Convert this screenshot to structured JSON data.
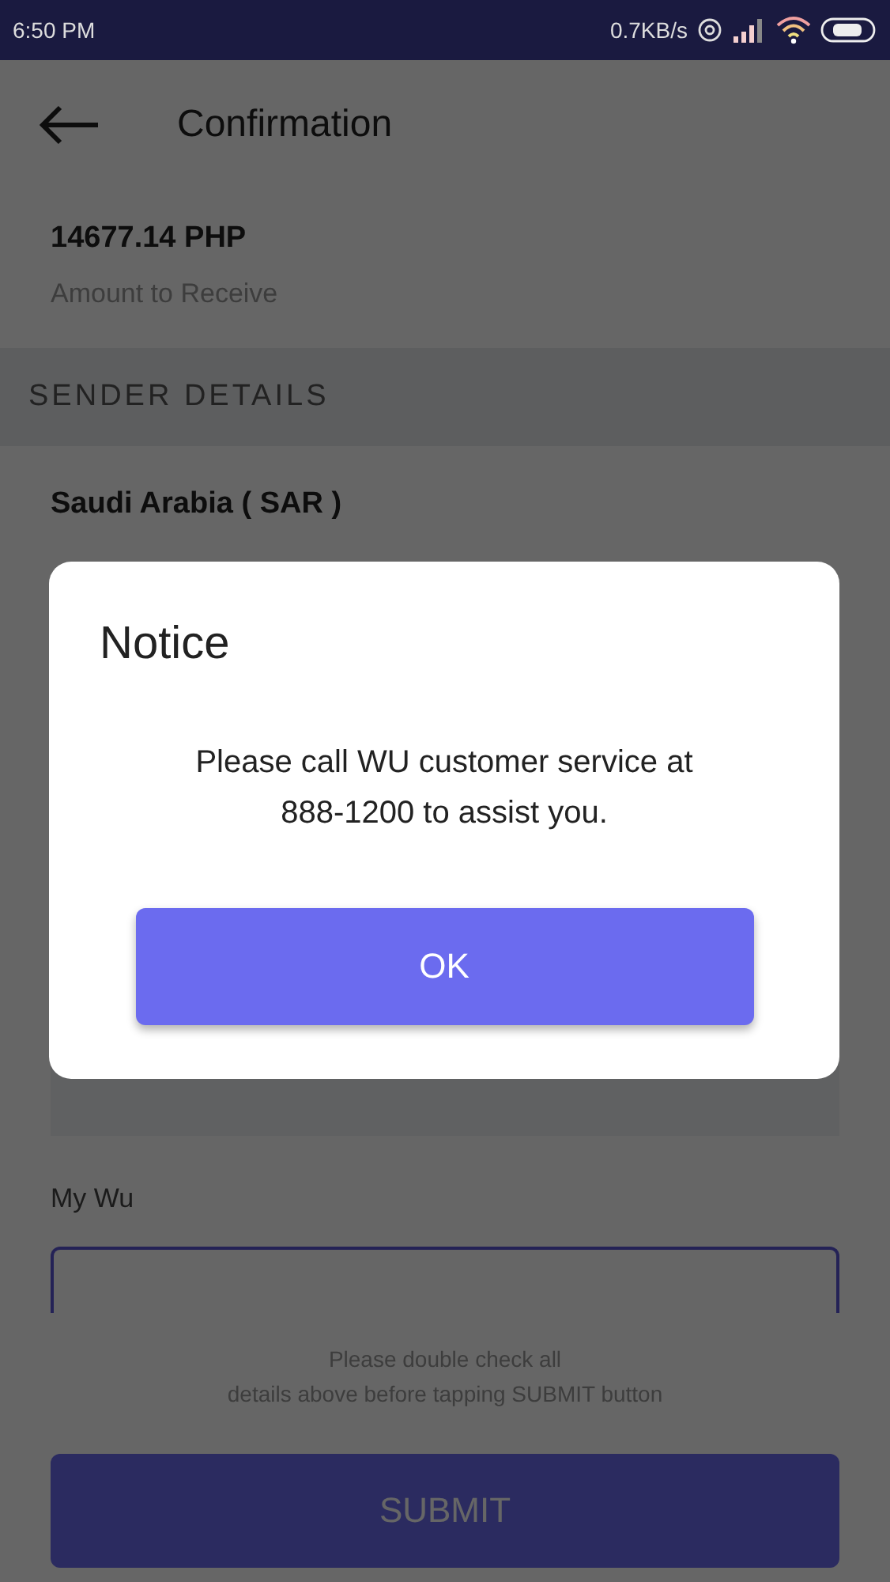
{
  "status_bar": {
    "time": "6:50 PM",
    "speed": "0.7KB/s"
  },
  "header": {
    "title": "Confirmation"
  },
  "amount": {
    "value": "14677.14 PHP",
    "label": "Amount to Receive"
  },
  "section": {
    "title": "SENDER DETAILS"
  },
  "sender": {
    "value": "Saudi Arabia ( SAR )"
  },
  "my_wu": {
    "label": "My Wu"
  },
  "note": {
    "lines": [
      "Please double check all",
      "details above before tapping SUBMIT button"
    ]
  },
  "submit": {
    "label": "SUBMIT"
  },
  "dialog": {
    "title": "Notice",
    "message": "Please call WU customer service at 888-1200 to assist you.",
    "button": "OK"
  }
}
